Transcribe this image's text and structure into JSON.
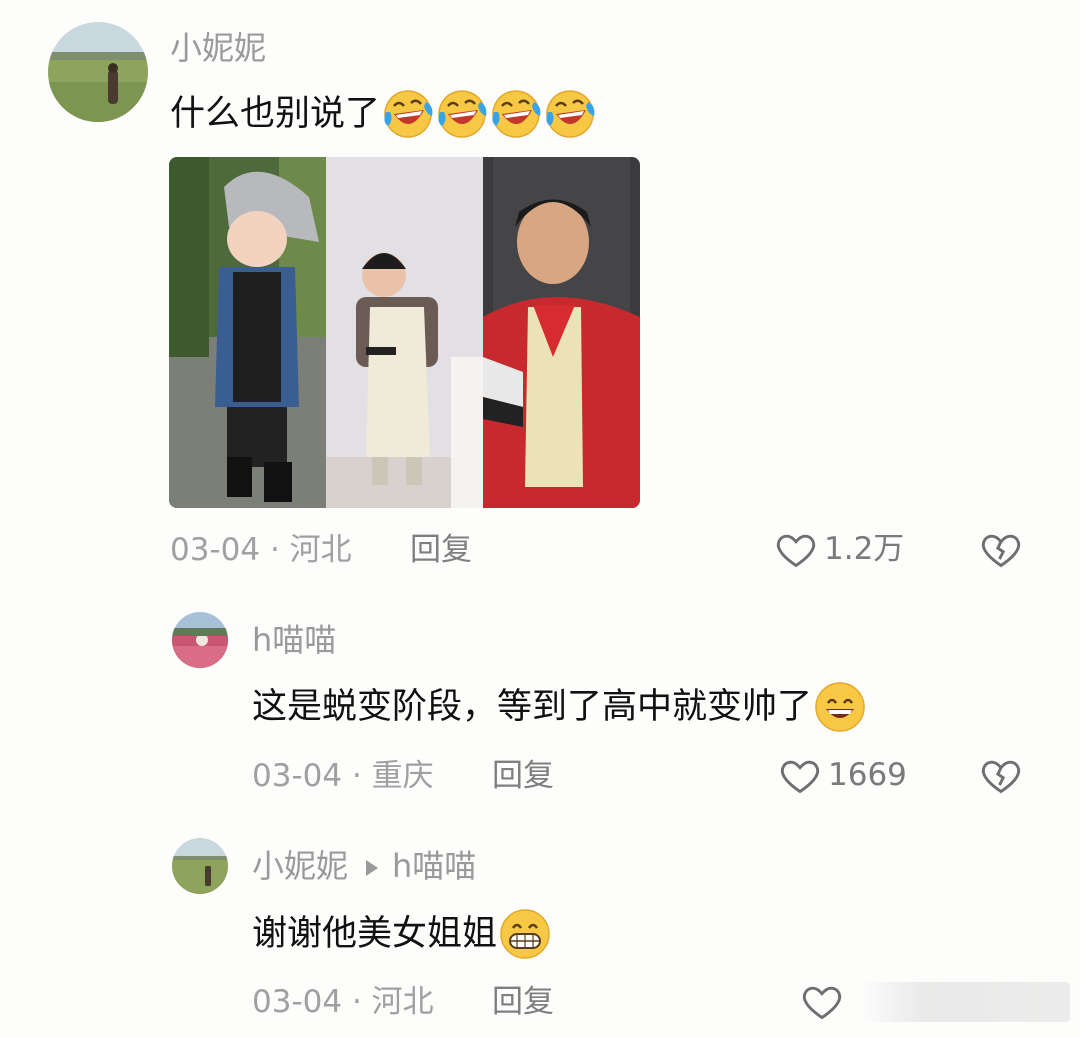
{
  "comment": {
    "user": "小妮妮",
    "text": "什么也别说了",
    "emoji_count": 4,
    "emoji": "laughing-tears-emoji",
    "date": "03-04",
    "location": "河北",
    "meta_sep": " · ",
    "reply_label": "回复",
    "likes": "1.2万"
  },
  "replies": [
    {
      "user": "h喵喵",
      "text": "这是蜕变阶段，等到了高中就变帅了",
      "emoji": "grin-emoji",
      "date": "03-04",
      "location": "重庆",
      "reply_label": "回复",
      "likes": "1669"
    },
    {
      "user": "小妮妮",
      "reply_to": "h喵喵",
      "text": "谢谢他美女姐姐",
      "emoji": "big-grin-emoji",
      "date": "03-04",
      "location": "河北",
      "reply_label": "回复",
      "likes": ""
    }
  ],
  "colors": {
    "background": "#fdfdfc",
    "username": "#9a9a9a",
    "meta": "#a0a0a0",
    "icon": "#6f6f6f"
  }
}
